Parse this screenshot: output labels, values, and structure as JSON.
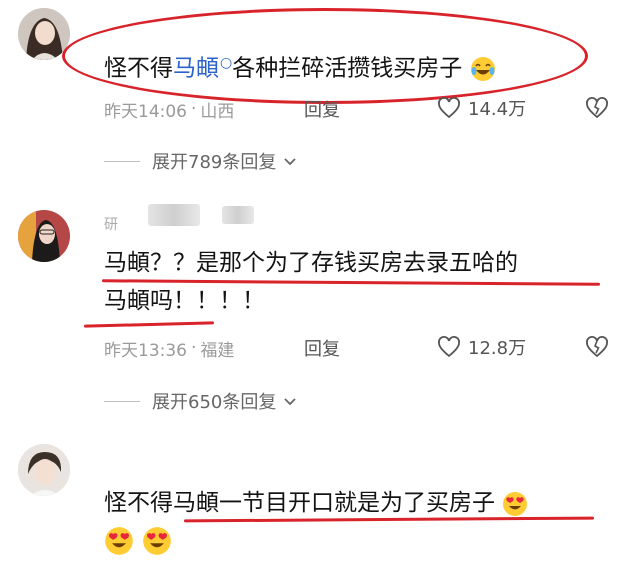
{
  "comments": [
    {
      "pre": "怪不得",
      "link": "马頔",
      "post": "各种拦碎活攒钱买房子",
      "time": "昨天14:06",
      "location": "山西",
      "reply_label": "回复",
      "likes": "14.4万",
      "expand": "展开789条回复"
    },
    {
      "username": "研",
      "line1": "马頔？？是那个为了存钱买房去录五哈的",
      "line2": "马頔吗！！！！",
      "time": "昨天13:36",
      "location": "福建",
      "reply_label": "回复",
      "likes": "12.8万",
      "expand": "展开650条回复"
    },
    {
      "text": "怪不得马頔一节目开口就是为了买房子"
    }
  ],
  "icons": {
    "like": "heart-outline-icon",
    "dislike": "broken-heart-icon",
    "expand": "chevron-down-icon",
    "emoji_laugh": "face-with-tears-of-joy-icon",
    "emoji_love": "heart-eyes-icon"
  },
  "colors": {
    "accent_link": "#2b63c9",
    "annotation_red": "#d8232a",
    "meta_gray": "#9a9a9a"
  }
}
